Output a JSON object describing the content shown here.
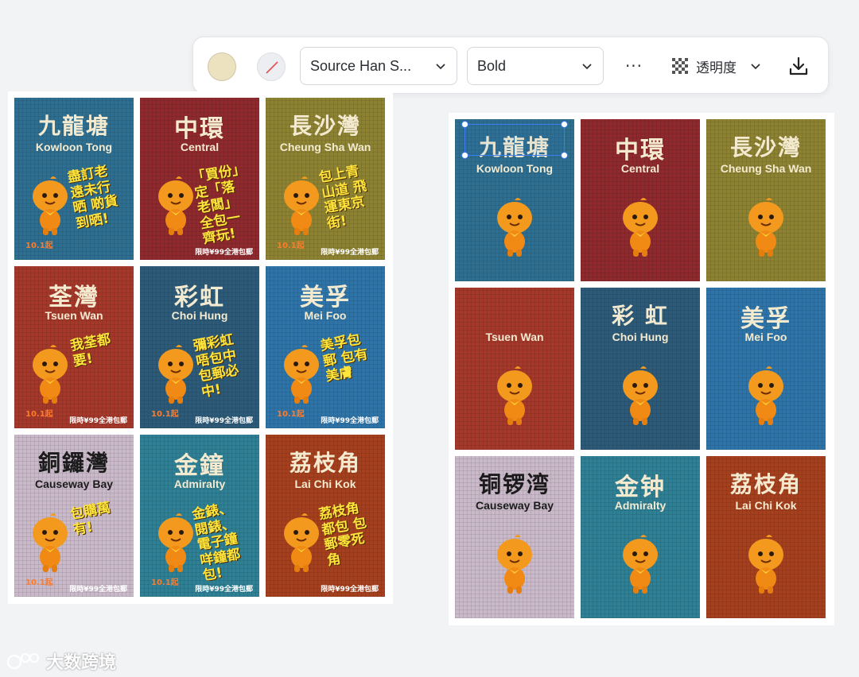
{
  "toolbar": {
    "text_color": "#ece2bf",
    "font_family": "Source Han S...",
    "font_weight": "Bold",
    "more": "···",
    "opacity_label": "透明度",
    "icons": {
      "color": "color-swatch-icon",
      "no_fill": "no-fill-icon",
      "dropdown": "chevron-down-icon",
      "opacity": "checkerboard-icon",
      "download": "download-icon"
    }
  },
  "left_collage": {
    "tiles": [
      {
        "cn": "九龍塘",
        "en": "Kowloon Tong",
        "bg": "#2e6f91",
        "slogan": "盡訂老遠未行晒 啲貨到晒!",
        "promo": "",
        "date": "10.1起"
      },
      {
        "cn": "中環",
        "en": "Central",
        "bg": "#8e2a2e",
        "slogan": "「買份」定「落老闆」 全包一齊玩!",
        "promo": "限時¥99全港包郵",
        "date": ""
      },
      {
        "cn": "長沙灣",
        "en": "Cheung Sha Wan",
        "bg": "#8d8232",
        "slogan": "包上青山道 飛運東京街!",
        "promo": "限時¥99全港包郵",
        "date": "10.1起"
      },
      {
        "cn": "荃灣",
        "en": "Tsuen Wan",
        "bg": "#a4382a",
        "slogan": "我荃都要!",
        "promo": "限時¥99全港包郵",
        "date": "10.1起"
      },
      {
        "cn": "彩虹",
        "en": "Choi Hung",
        "bg": "#2d5a78",
        "slogan": "彌彩虹唔包中 包郵必中!",
        "promo": "限時¥99全港包郵",
        "date": "10.1起"
      },
      {
        "cn": "美孚",
        "en": "Mei Foo",
        "bg": "#2f74a8",
        "slogan": "美孚包郵 包有美膚",
        "promo": "限時¥99全港包郵",
        "date": "10.1起"
      },
      {
        "cn": "銅鑼灣",
        "en": "Causeway Bay",
        "bg": "#c9b9c9",
        "slogan": "包購萬有!",
        "promo": "限時¥99全港包郵",
        "date": "10.1起"
      },
      {
        "cn": "金鐘",
        "en": "Admiralty",
        "bg": "#2f7f95",
        "slogan": "金錶、閱錶、電子鐘 咩鐘都包!",
        "promo": "限時¥99全港包郵",
        "date": "10.1起"
      },
      {
        "cn": "荔枝角",
        "en": "Lai Chi Kok",
        "bg": "#a5401e",
        "slogan": "荔枝角都包 包郵零死角",
        "promo": "限時¥99全港包郵",
        "date": ""
      }
    ]
  },
  "right_collage": {
    "tiles": [
      {
        "cn": "九龍塘",
        "en": "Kowloon Tong",
        "bg": "#2e6f91"
      },
      {
        "cn": "中環",
        "en": "Central",
        "bg": "#8e2a2e"
      },
      {
        "cn": "長沙灣",
        "en": "Cheung Sha Wan",
        "bg": "#8d8232"
      },
      {
        "cn": "",
        "en": "Tsuen Wan",
        "bg": "#a4382a"
      },
      {
        "cn": "彩 虹",
        "en": "Choi Hung",
        "bg": "#2d5a78"
      },
      {
        "cn": "美孚",
        "en": "Mei Foo",
        "bg": "#2f74a8"
      },
      {
        "cn": "铜锣湾",
        "en": "Causeway Bay",
        "bg": "#c9b9c9"
      },
      {
        "cn": "金钟",
        "en": "Admiralty",
        "bg": "#2f7f95"
      },
      {
        "cn": "荔枝角",
        "en": "Lai Chi Kok",
        "bg": "#a5401e"
      }
    ]
  },
  "watermark": {
    "text": "大数跨境"
  }
}
